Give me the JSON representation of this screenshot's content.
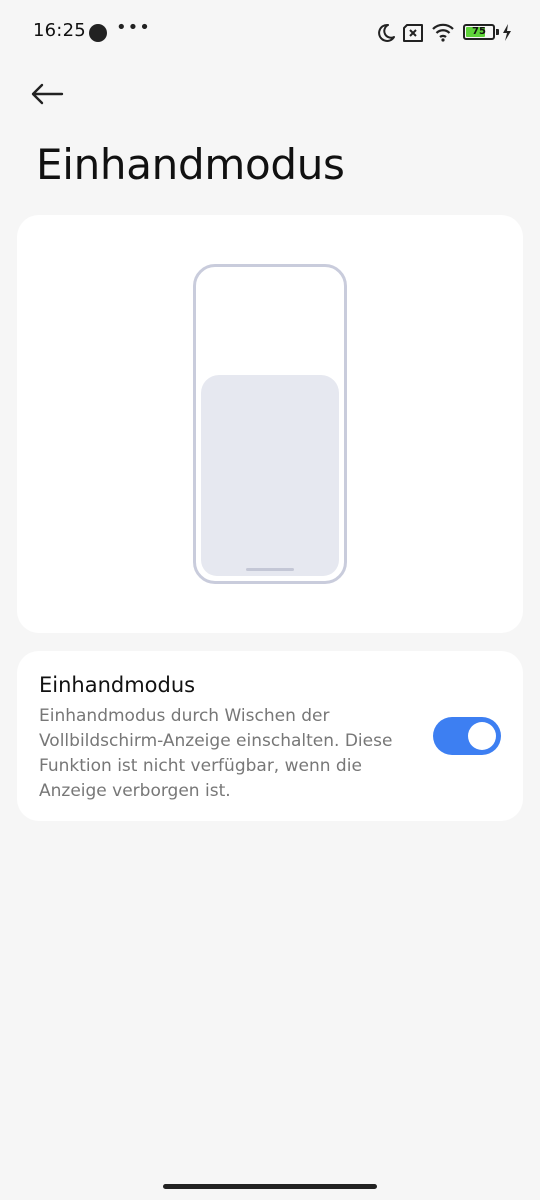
{
  "status_bar": {
    "time": "16:25",
    "more": "•••",
    "battery_level": "75",
    "battery_percent": 75,
    "battery_color": "#5fd33a"
  },
  "header": {
    "back_icon": "arrow-left-icon",
    "title": "Einhandmodus"
  },
  "illustration": {
    "icon": "phone-one-handed-illustration"
  },
  "setting": {
    "title": "Einhandmodus",
    "description": "Einhandmodus durch Wischen der Vollbildschirm-Anzeige einschalten. Diese Funktion ist nicht verfügbar, wenn die Anzeige verborgen ist.",
    "enabled": true,
    "accent_color": "#3d7ff2"
  }
}
